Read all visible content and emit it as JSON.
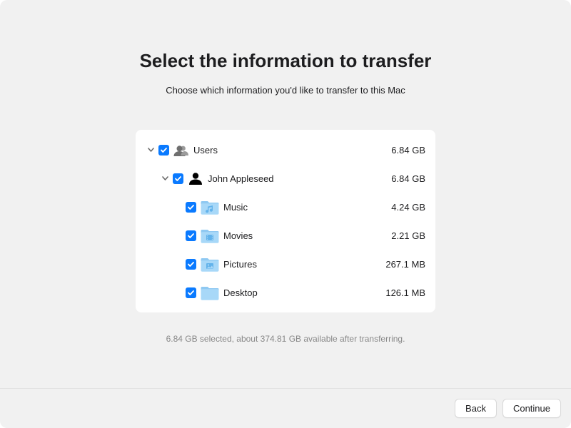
{
  "title": "Select the information to transfer",
  "subtitle": "Choose which information you'd like to transfer to this Mac",
  "tree": {
    "users": {
      "label": "Users",
      "size": "6.84 GB",
      "account": {
        "label": "John Appleseed",
        "size": "6.84 GB",
        "items": [
          {
            "label": "Music",
            "size": "4.24 GB",
            "kind": "music"
          },
          {
            "label": "Movies",
            "size": "2.21 GB",
            "kind": "movies"
          },
          {
            "label": "Pictures",
            "size": "267.1 MB",
            "kind": "pictures"
          },
          {
            "label": "Desktop",
            "size": "126.1 MB",
            "kind": "desktop"
          }
        ]
      }
    }
  },
  "status": "6.84 GB selected, about 374.81 GB available after transferring.",
  "buttons": {
    "back": "Back",
    "continue": "Continue"
  }
}
